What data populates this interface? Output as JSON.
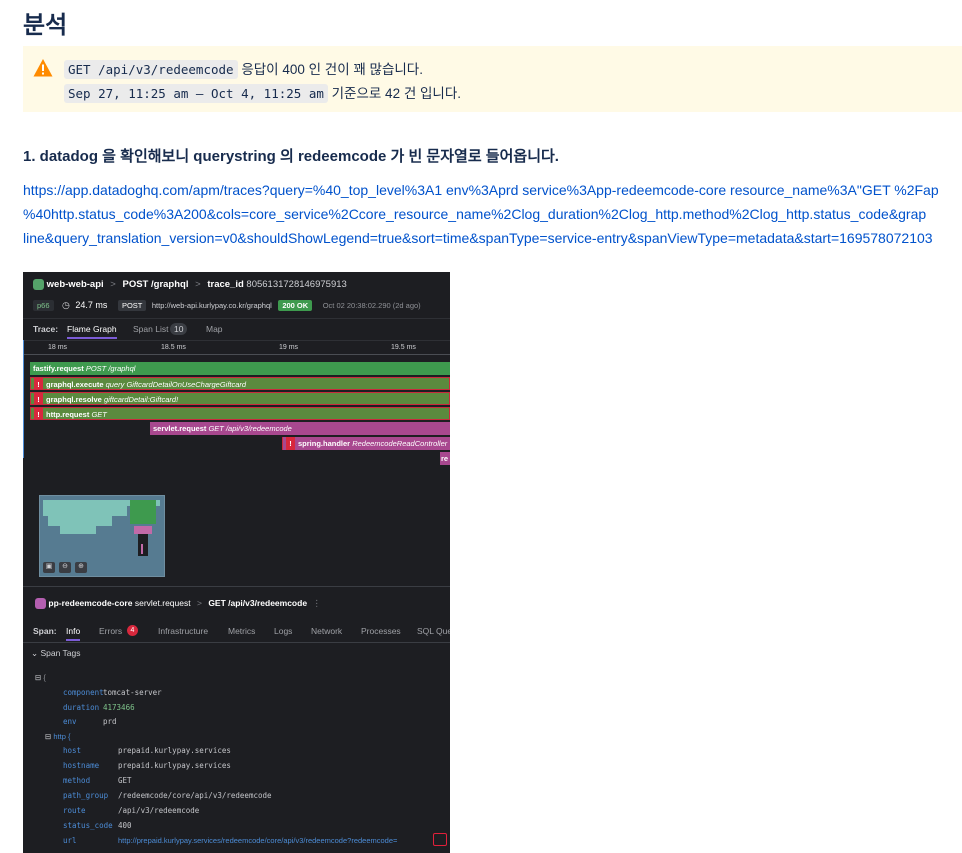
{
  "page": {
    "title": "분석"
  },
  "warning": {
    "line1_code": "GET /api/v3/redeemcode",
    "line1_text": " 응답이 400 인 건이 꽤 많습니다.",
    "line2_code": "Sep 27, 11:25 am — Oct 4, 11:25 am",
    "line2_text": " 기준으로 42 건 입니다.",
    "icon": "warning-triangle-icon",
    "color": "#fffae6"
  },
  "section": {
    "heading": "1. datadog 을 확인해보니 querystring 의 redeemcode 가 빈 문자열로 들어옵니다.",
    "link_lines": [
      "https://app.datadoghq.com/apm/traces?query=%40_top_level%3A1 env%3Aprd service%3App-redeemcode-core resource_name%3A\"GET %2Fap",
      "%40http.status_code%3A200&cols=core_service%2Ccore_resource_name%2Clog_duration%2Clog_http.method%2Clog_http.status_code&grap",
      "line&query_translation_version=v0&shouldShowLegend=true&sort=time&spanType=service-entry&spanViewType=metadata&start=169578072103"
    ],
    "link_color": "#0052cc"
  },
  "datadog": {
    "header": {
      "service": "web-web-api",
      "sep1": ">",
      "operation": "POST /graphql",
      "sep2": ">",
      "trace_label": "trace_id",
      "trace_id": "8056131728146975913"
    },
    "meta": {
      "p_badge": "p66",
      "duration": "24.7 ms",
      "method": "POST",
      "url": "http://web-api.kurlypay.co.kr/graphql",
      "status": "200 OK",
      "time": "Oct 02 20:38:02.290 (2d ago)"
    },
    "tabs": {
      "label": "Trace:",
      "items": [
        "Flame Graph",
        "Span List",
        "Map"
      ],
      "span_count": "10"
    },
    "ticks": [
      "18 ms",
      "18.5 ms",
      "19 ms",
      "19.5 ms"
    ],
    "flames": [
      {
        "name": "fastify.request",
        "detail": "POST /graphql"
      },
      {
        "name": "graphql.execute",
        "detail": "query GiftcardDetailOnUseChargeGiftcard"
      },
      {
        "name": "graphql.resolve",
        "detail": "giftcardDetail:Giftcard!"
      },
      {
        "name": "http.request",
        "detail": "GET"
      },
      {
        "name": "servlet.request",
        "detail": "GET /api/v3/redeemcode"
      },
      {
        "name": "spring.handler",
        "detail": "RedeemcodeReadController"
      },
      {
        "name": "re",
        "detail": ""
      }
    ],
    "error_mark": "!",
    "span_header": {
      "service": "pp-redeemcode-core",
      "operation": "servlet.request",
      "sep": ">",
      "resource": "GET /api/v3/redeemcode"
    },
    "span_tabs": {
      "label": "Span:",
      "items": [
        "Info",
        "Errors",
        "Infrastructure",
        "Metrics",
        "Logs",
        "Network",
        "Processes",
        "SQL Que"
      ],
      "error_count": "4"
    },
    "span_tags_label": "Span Tags",
    "json_open": "{",
    "tags": [
      {
        "key": "component",
        "value": "tomcat-server"
      },
      {
        "key": "duration",
        "value": "4173466"
      },
      {
        "key": "env",
        "value": "prd"
      }
    ],
    "http_label": "http {",
    "http_tags": [
      {
        "key": "host",
        "value": "prepaid.kurlypay.services"
      },
      {
        "key": "hostname",
        "value": "prepaid.kurlypay.services"
      },
      {
        "key": "method",
        "value": "GET"
      },
      {
        "key": "path_group",
        "value": "/redeemcode/core/api/v3/redeemcode"
      },
      {
        "key": "route",
        "value": "/api/v3/redeemcode"
      },
      {
        "key": "status_code",
        "value": "400"
      },
      {
        "key": "url",
        "value": "http://prepaid.kurlypay.services/redeemcode/core/api/v3/redeemcode?redeemcode="
      }
    ]
  }
}
